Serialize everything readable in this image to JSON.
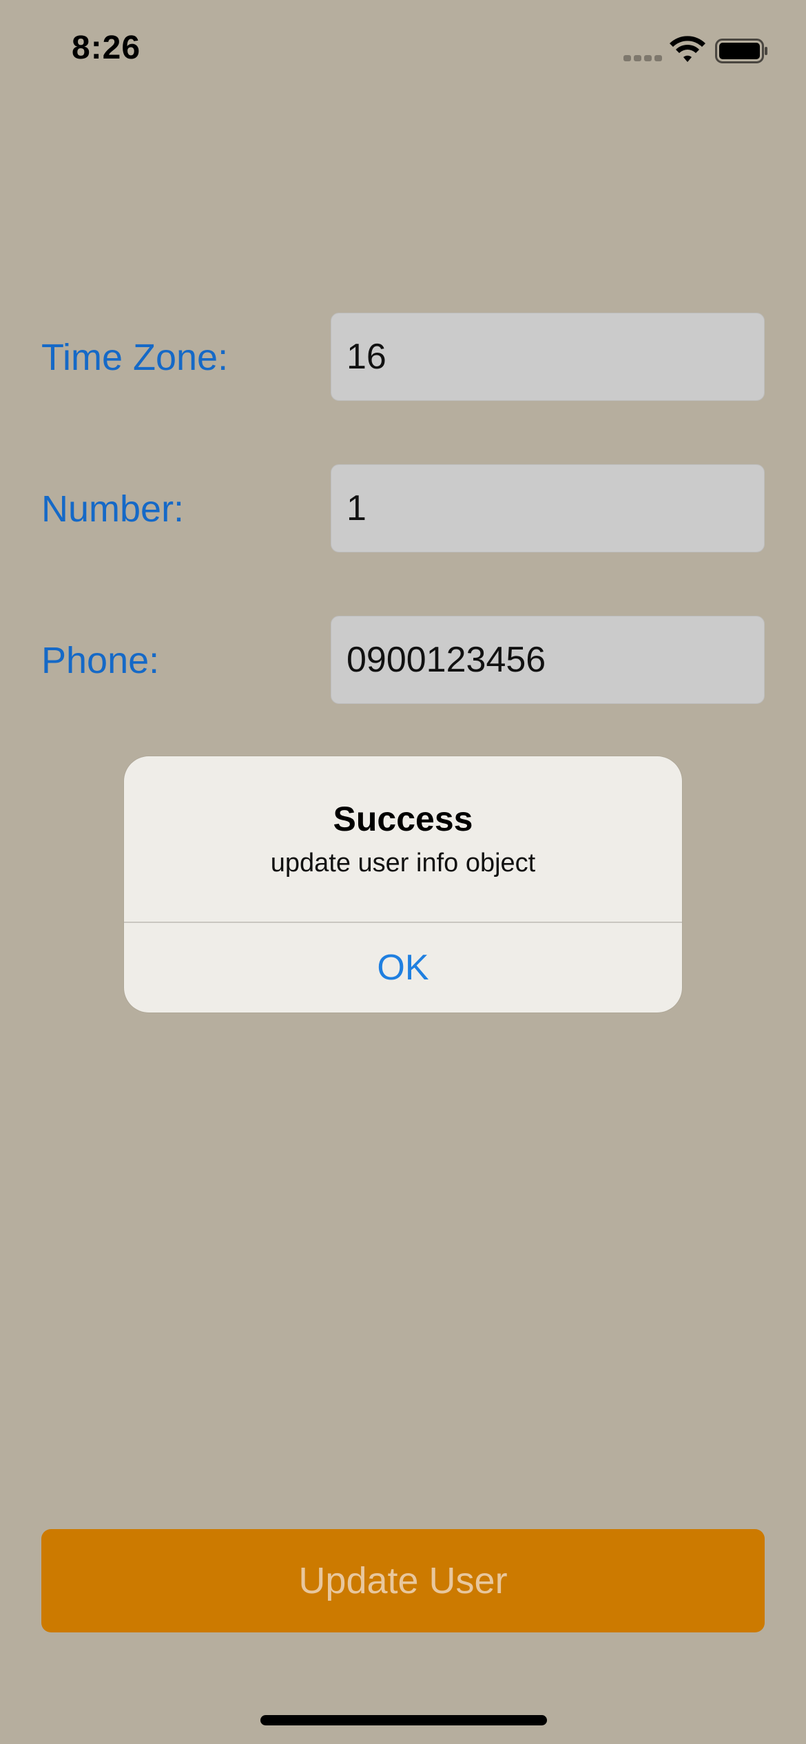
{
  "status_bar": {
    "time": "8:26",
    "signal_icon": "cellular-signal-icon",
    "wifi_icon": "wifi-icon",
    "battery_icon": "battery-icon"
  },
  "form": {
    "time_zone": {
      "label": "Time Zone:",
      "value": "16"
    },
    "number": {
      "label": "Number:",
      "value": "1"
    },
    "phone": {
      "label": "Phone:",
      "value": "0900123456"
    }
  },
  "alert": {
    "title": "Success",
    "message": "update user info object",
    "ok_label": "OK"
  },
  "update_button": {
    "label": "Update User"
  },
  "colors": {
    "background": "#b6ae9e",
    "label_blue": "#1569c7",
    "button_orange": "#cc7a00",
    "ok_blue": "#1f7fe0"
  }
}
